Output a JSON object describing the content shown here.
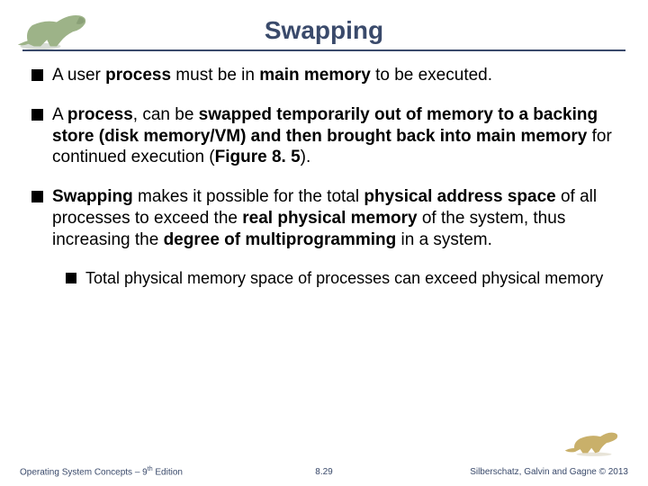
{
  "title": "Swapping",
  "bullets": [
    {
      "segments": [
        {
          "t": "A user ",
          "b": false
        },
        {
          "t": "process",
          "b": true
        },
        {
          "t": " must be in ",
          "b": false
        },
        {
          "t": "main memory",
          "b": true
        },
        {
          "t": " to be executed.",
          "b": false
        }
      ]
    },
    {
      "segments": [
        {
          "t": "A ",
          "b": false
        },
        {
          "t": "process",
          "b": true
        },
        {
          "t": ", can be ",
          "b": false
        },
        {
          "t": "swapped temporarily out of memory to a backing store (disk memory/VM) and then brought back into main memory",
          "b": true
        },
        {
          "t": " for continued execution (",
          "b": false
        },
        {
          "t": "Figure 8. 5",
          "b": true
        },
        {
          "t": ").",
          "b": false
        }
      ]
    },
    {
      "segments": [
        {
          "t": "Swapping",
          "b": true
        },
        {
          "t": " makes it possible for the total ",
          "b": false
        },
        {
          "t": "physical address space",
          "b": true
        },
        {
          "t": " of all processes to exceed the ",
          "b": false
        },
        {
          "t": "real physical memory",
          "b": true
        },
        {
          "t": " of the system, thus increasing the ",
          "b": false
        },
        {
          "t": "degree of  multiprogramming",
          "b": true
        },
        {
          "t": " in a system.",
          "b": false
        }
      ],
      "sub": [
        {
          "segments": [
            {
              "t": "Total physical memory space of processes can exceed physical memory",
              "b": false
            }
          ]
        }
      ]
    }
  ],
  "footer": {
    "left_prefix": "Operating System Concepts – 9",
    "left_sup": "th",
    "left_suffix": " Edition",
    "center": "8.29",
    "right": "Silberschatz, Galvin and Gagne © 2013"
  }
}
